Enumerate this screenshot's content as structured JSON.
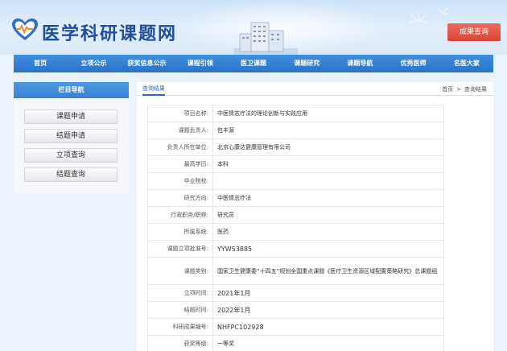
{
  "header": {
    "site_title": "医学科研课题网",
    "result_button": "成果查询"
  },
  "nav": {
    "items": [
      "首页",
      "立项公示",
      "获奖信息公示",
      "课程引领",
      "医卫课题",
      "课题研究",
      "课题导航",
      "优秀医师",
      "名医大家"
    ]
  },
  "sidebar": {
    "title": "栏目导航",
    "items": [
      "课题申请",
      "结题申请",
      "立项查询",
      "结题查询"
    ]
  },
  "main": {
    "tab": "查询结果",
    "breadcrumb": {
      "home": "首页",
      "separator": ">",
      "current": "查询结果"
    }
  },
  "record": [
    {
      "key": "项目名称:",
      "value": "中医情志疗法的理论创新与实践应用"
    },
    {
      "key": "课题负责人:",
      "value": "包丰源"
    },
    {
      "key": "负责人所在单位:",
      "value": "北京心康达健康管理有限公司"
    },
    {
      "key": "最高学历:",
      "value": "本科"
    },
    {
      "key": "毕业院校:",
      "value": ""
    },
    {
      "key": "研究方向:",
      "value": "中医情志疗法"
    },
    {
      "key": "行政职务/职称:",
      "value": "研究员"
    },
    {
      "key": "所属系统:",
      "value": "医药"
    },
    {
      "key": "课题立项批准号:",
      "value": "YYWS3885"
    },
    {
      "key": "课题类别:",
      "value": "国家卫生健康委“十四五”规划全国重点课题《医疗卫生资源区域配置策略研究》总课题组"
    },
    {
      "key": "立项时间:",
      "value": "2021年1月"
    },
    {
      "key": "结题时间:",
      "value": "2022年1月"
    },
    {
      "key": "科研成果编号:",
      "value": "NHFPC102928"
    },
    {
      "key": "获奖等级:",
      "value": "一等奖"
    }
  ]
}
